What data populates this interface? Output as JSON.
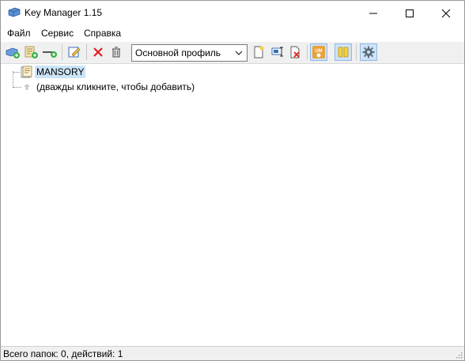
{
  "window": {
    "title": "Key Manager 1.15",
    "controls": [
      "minimize-icon",
      "maximize-icon",
      "close-icon"
    ]
  },
  "menu": {
    "file": "Файл",
    "service": "Сервис",
    "help": "Справка"
  },
  "toolbar": {
    "profile_selected": "Основной профиль",
    "buttons": [
      {
        "name": "new-key-icon"
      },
      {
        "name": "new-folder-icon"
      },
      {
        "name": "separator-line-icon"
      },
      {
        "name": "edit-icon"
      },
      {
        "name": "delete-icon"
      },
      {
        "name": "trash-icon"
      },
      {
        "name": "new-profile-icon"
      },
      {
        "name": "rename-profile-icon"
      },
      {
        "name": "delete-profile-icon"
      },
      {
        "name": "um-logo-icon"
      },
      {
        "name": "columns-icon"
      },
      {
        "name": "settings-gear-icon"
      }
    ],
    "accent_active": "#cfe3f7"
  },
  "tree": {
    "folder_label": "MANSORY",
    "add_hint": "(дважды кликните, чтобы добавить)"
  },
  "status": {
    "text": "Всего папок: 0, действий: 1"
  },
  "colors": {
    "selection": "#cce4f7",
    "toolbar_bg": "#f0f0f0"
  }
}
